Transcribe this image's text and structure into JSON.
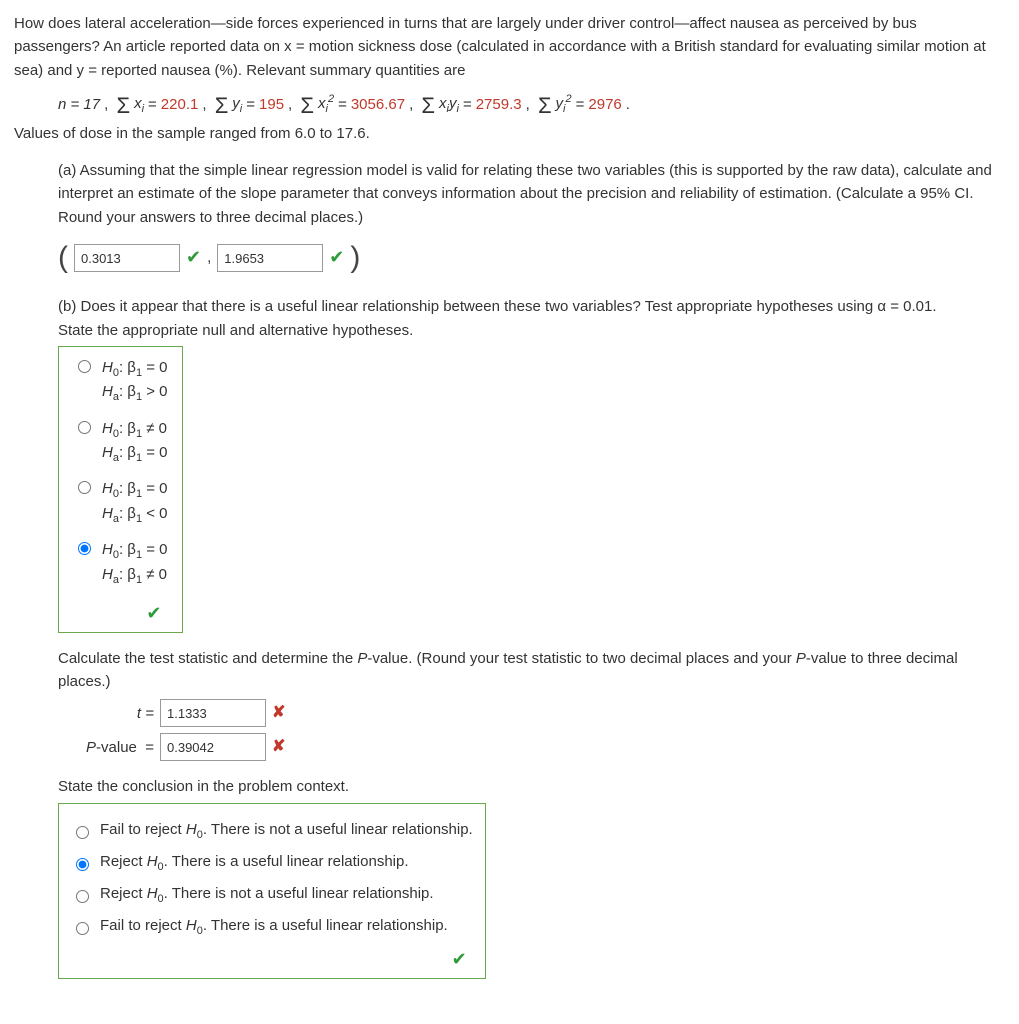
{
  "intro": {
    "p1": "How does lateral acceleration—side forces experienced in turns that are largely under driver control—affect nausea as perceived by bus passengers? An article reported data on x = motion sickness dose (calculated in accordance with a British standard for evaluating similar motion at sea) and y = reported nausea (%). Relevant summary quantities are"
  },
  "summary": {
    "n_label": "n = 17",
    "sum_x": "220.1",
    "sum_y": "195",
    "sum_x2": "3056.67",
    "sum_xy": "2759.3",
    "sum_y2": "2976",
    "range_line": "Values of dose in the sample ranged from 6.0 to 17.6."
  },
  "partA": {
    "prompt": "(a) Assuming that the simple linear regression model is valid for relating these two variables (this is supported by the raw data), calculate and interpret an estimate of the slope parameter that conveys information about the precision and reliability of estimation. (Calculate a 95% CI. Round your answers to three decimal places.)",
    "ci_lo": "0.3013",
    "ci_hi": "1.9653",
    "comma": ","
  },
  "partB": {
    "prompt1": "(b) Does it appear that there is a useful linear relationship between these two variables? Test appropriate hypotheses using α = 0.01.",
    "prompt2": "State the appropriate null and alternative hypotheses.",
    "options": [
      {
        "h0": "H",
        "h0sub": "0",
        "h0rest": ": β",
        "h0sub2": "1",
        "h0tail": " = 0",
        "ha": "H",
        "hasub": "a",
        "harest": ": β",
        "hasub2": "1",
        "hatail": " > 0"
      },
      {
        "h0": "H",
        "h0sub": "0",
        "h0rest": ": β",
        "h0sub2": "1",
        "h0tail": " ≠ 0",
        "ha": "H",
        "hasub": "a",
        "harest": ": β",
        "hasub2": "1",
        "hatail": " = 0"
      },
      {
        "h0": "H",
        "h0sub": "0",
        "h0rest": ": β",
        "h0sub2": "1",
        "h0tail": " = 0",
        "ha": "H",
        "hasub": "a",
        "harest": ": β",
        "hasub2": "1",
        "hatail": " < 0"
      },
      {
        "h0": "H",
        "h0sub": "0",
        "h0rest": ": β",
        "h0sub2": "1",
        "h0tail": " = 0",
        "ha": "H",
        "hasub": "a",
        "harest": ": β",
        "hasub2": "1",
        "hatail": " ≠ 0"
      }
    ]
  },
  "test": {
    "prompt": "Calculate the test statistic and determine the P-value. (Round your test statistic to two decimal places and your P-value to three decimal places.)",
    "t_label": "t  =",
    "t_val": "1.1333",
    "p_label": "P-value  =",
    "p_val": "0.39042"
  },
  "conclusion": {
    "prompt": "State the conclusion in the problem context.",
    "options": [
      "Fail to reject H₀. There is not a useful linear relationship.",
      "Reject H₀. There is a useful linear relationship.",
      "Reject H₀. There is not a useful linear relationship.",
      "Fail to reject H₀. There is a useful linear relationship."
    ]
  }
}
